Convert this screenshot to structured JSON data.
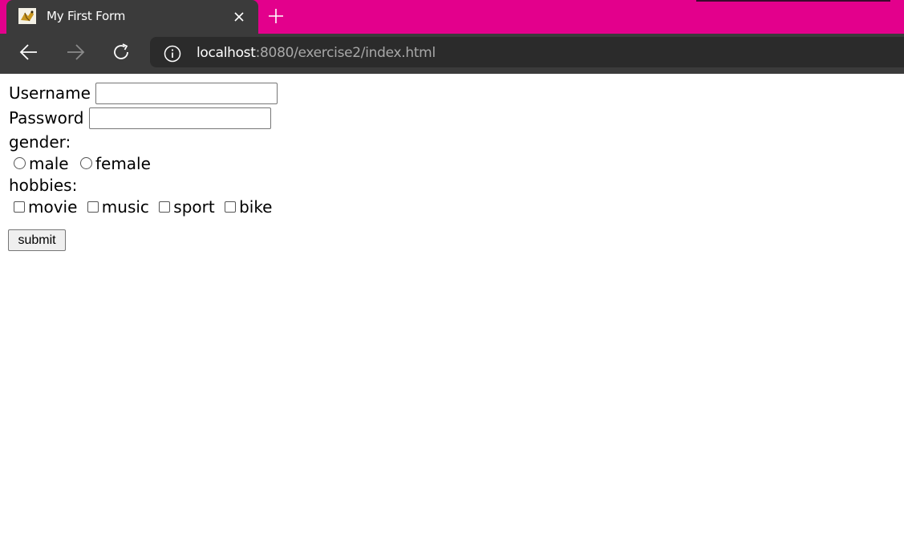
{
  "browser": {
    "tab_title": "My First Form",
    "url_host": "localhost",
    "url_rest": ":8080/exercise2/index.html",
    "colors": {
      "tabbar": "#e3008c",
      "chrome": "#3b3b3b",
      "omnibox": "#2b2b2b"
    },
    "icons": [
      "tab-favicon-icon",
      "close-icon",
      "plus-icon",
      "back-arrow-icon",
      "forward-arrow-icon",
      "refresh-icon",
      "info-icon"
    ]
  },
  "form": {
    "username_label": "Username",
    "username_value": "",
    "password_label": "Password",
    "password_value": "",
    "gender_label": "gender:",
    "gender_options": [
      "male",
      "female"
    ],
    "hobbies_label": "hobbies:",
    "hobby_options": [
      "movie",
      "music",
      "sport",
      "bike"
    ],
    "submit_label": "submit"
  }
}
